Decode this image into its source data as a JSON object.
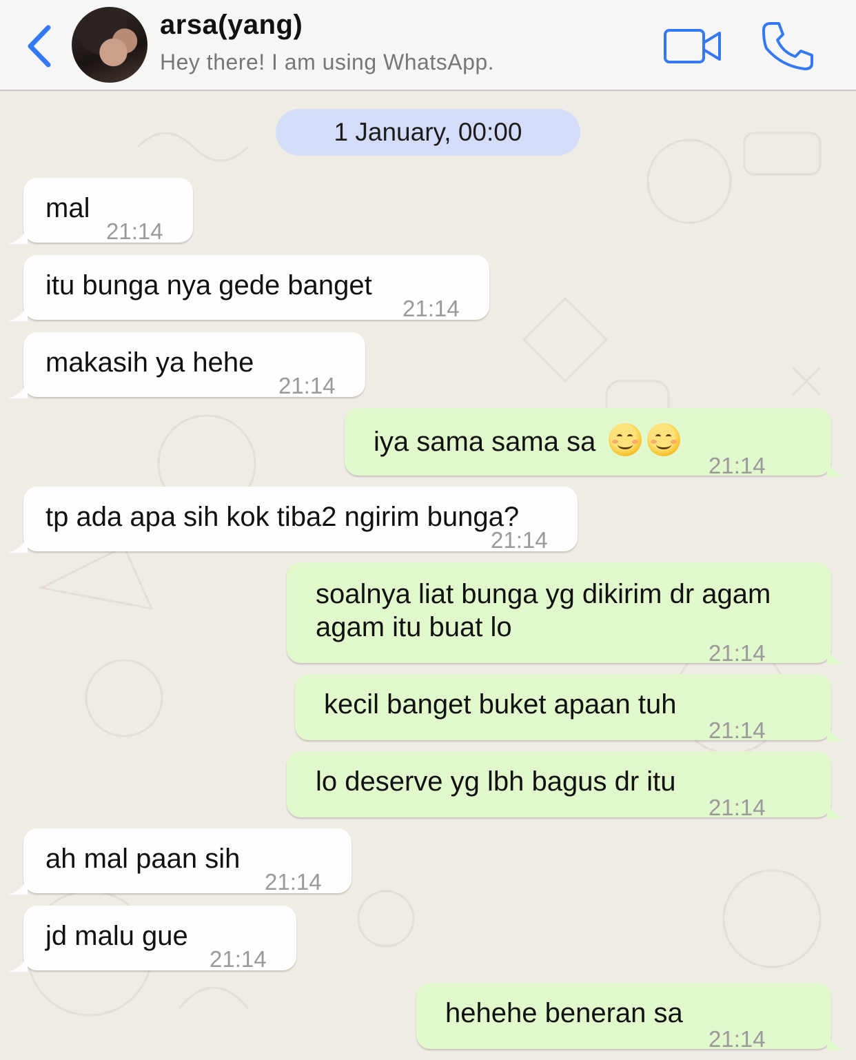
{
  "header": {
    "contact_name": "arsa(yang)",
    "contact_status": "Hey there! I am using WhatsApp.",
    "back_icon": "chevron-left-icon",
    "video_icon": "video-camera-icon",
    "call_icon": "phone-icon",
    "accent_color": "#3478f6"
  },
  "chat": {
    "date_label": "1 January, 00:00",
    "messages": [
      {
        "direction": "in",
        "text": "mal",
        "time": "21:14"
      },
      {
        "direction": "in",
        "text": "itu bunga nya gede banget",
        "time": "21:14"
      },
      {
        "direction": "in",
        "text": "makasih ya hehe",
        "time": "21:14"
      },
      {
        "direction": "out",
        "text": "iya sama sama sa",
        "emoji": "😊😊",
        "time": "21:14"
      },
      {
        "direction": "in",
        "text": "tp ada apa sih kok tiba2 ngirim bunga?",
        "time": "21:14"
      },
      {
        "direction": "out",
        "text_line1": "soalnya liat bunga yg dikirim dr agam",
        "text_line2": "agam itu buat lo",
        "time": "21:14"
      },
      {
        "direction": "out",
        "text": "kecil banget buket apaan tuh",
        "time": "21:14"
      },
      {
        "direction": "out",
        "text": "lo deserve yg lbh bagus dr itu",
        "time": "21:14"
      },
      {
        "direction": "in",
        "text": "ah mal paan sih",
        "time": "21:14"
      },
      {
        "direction": "in",
        "text": "jd malu gue",
        "time": "21:14"
      },
      {
        "direction": "out",
        "text": "hehehe beneran sa",
        "time": "21:14"
      }
    ],
    "incoming_color": "#fdfdfd",
    "outgoing_color": "#e1f7cc",
    "date_pill_color": "#d4dcf8"
  }
}
